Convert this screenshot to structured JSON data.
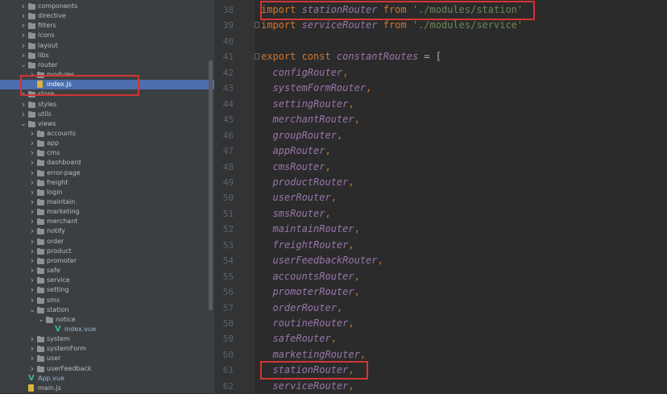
{
  "project_tree": {
    "items": [
      {
        "label": "components",
        "depth": 0,
        "type": "folder",
        "expanded": false
      },
      {
        "label": "directive",
        "depth": 0,
        "type": "folder",
        "expanded": false
      },
      {
        "label": "filters",
        "depth": 0,
        "type": "folder",
        "expanded": false
      },
      {
        "label": "icons",
        "depth": 0,
        "type": "folder",
        "expanded": false
      },
      {
        "label": "layout",
        "depth": 0,
        "type": "folder",
        "expanded": false
      },
      {
        "label": "libs",
        "depth": 0,
        "type": "folder",
        "expanded": false
      },
      {
        "label": "router",
        "depth": 0,
        "type": "folder",
        "expanded": true
      },
      {
        "label": "modules",
        "depth": 1,
        "type": "folder",
        "expanded": false
      },
      {
        "label": "index.js",
        "depth": 1,
        "type": "js",
        "selected": true
      },
      {
        "label": "store",
        "depth": 0,
        "type": "folder",
        "expanded": false
      },
      {
        "label": "styles",
        "depth": 0,
        "type": "folder",
        "expanded": false
      },
      {
        "label": "utils",
        "depth": 0,
        "type": "folder",
        "expanded": false
      },
      {
        "label": "views",
        "depth": 0,
        "type": "folder",
        "expanded": true
      },
      {
        "label": "accounts",
        "depth": 1,
        "type": "folder",
        "expanded": false
      },
      {
        "label": "app",
        "depth": 1,
        "type": "folder",
        "expanded": false
      },
      {
        "label": "cms",
        "depth": 1,
        "type": "folder",
        "expanded": false
      },
      {
        "label": "dashboard",
        "depth": 1,
        "type": "folder",
        "expanded": false
      },
      {
        "label": "error-page",
        "depth": 1,
        "type": "folder",
        "expanded": false
      },
      {
        "label": "freight",
        "depth": 1,
        "type": "folder",
        "expanded": false
      },
      {
        "label": "login",
        "depth": 1,
        "type": "folder",
        "expanded": false
      },
      {
        "label": "maintain",
        "depth": 1,
        "type": "folder",
        "expanded": false
      },
      {
        "label": "marketing",
        "depth": 1,
        "type": "folder",
        "expanded": false
      },
      {
        "label": "merchant",
        "depth": 1,
        "type": "folder",
        "expanded": false
      },
      {
        "label": "notify",
        "depth": 1,
        "type": "folder",
        "expanded": false
      },
      {
        "label": "order",
        "depth": 1,
        "type": "folder",
        "expanded": false
      },
      {
        "label": "product",
        "depth": 1,
        "type": "folder",
        "expanded": false
      },
      {
        "label": "promoter",
        "depth": 1,
        "type": "folder",
        "expanded": false
      },
      {
        "label": "safe",
        "depth": 1,
        "type": "folder",
        "expanded": false
      },
      {
        "label": "service",
        "depth": 1,
        "type": "folder",
        "expanded": false
      },
      {
        "label": "setting",
        "depth": 1,
        "type": "folder",
        "expanded": false
      },
      {
        "label": "sms",
        "depth": 1,
        "type": "folder",
        "expanded": false
      },
      {
        "label": "station",
        "depth": 1,
        "type": "folder",
        "expanded": true
      },
      {
        "label": "notice",
        "depth": 2,
        "type": "folder",
        "expanded": true
      },
      {
        "label": "index.vue",
        "depth": 3,
        "type": "vue"
      },
      {
        "label": "system",
        "depth": 1,
        "type": "folder",
        "expanded": false
      },
      {
        "label": "systemForm",
        "depth": 1,
        "type": "folder",
        "expanded": false
      },
      {
        "label": "user",
        "depth": 1,
        "type": "folder",
        "expanded": false
      },
      {
        "label": "userFeedback",
        "depth": 1,
        "type": "folder",
        "expanded": false
      },
      {
        "label": "App.vue",
        "depth": 0,
        "type": "vue"
      },
      {
        "label": "main.js",
        "depth": 0,
        "type": "js"
      }
    ]
  },
  "editor": {
    "lines": [
      {
        "num": "38",
        "tokens": [
          [
            "kw",
            "import "
          ],
          [
            "id",
            "stationRouter"
          ],
          [
            "kw",
            " from "
          ],
          [
            "str",
            "'./modules/station'"
          ]
        ]
      },
      {
        "num": "39",
        "tokens": [
          [
            "kw",
            "import "
          ],
          [
            "id",
            "serviceRouter"
          ],
          [
            "kw",
            " from "
          ],
          [
            "str",
            "'./modules/service'"
          ]
        ],
        "fold": true
      },
      {
        "num": "40",
        "tokens": []
      },
      {
        "num": "41",
        "tokens": [
          [
            "kw",
            "export const "
          ],
          [
            "id",
            "constantRoutes"
          ],
          [
            "plain",
            " = ["
          ]
        ],
        "fold": true
      },
      {
        "num": "42",
        "tokens": [
          [
            "plain",
            "  "
          ],
          [
            "id",
            "configRouter"
          ],
          [
            "pun",
            ","
          ]
        ]
      },
      {
        "num": "43",
        "tokens": [
          [
            "plain",
            "  "
          ],
          [
            "id",
            "systemFormRouter"
          ],
          [
            "pun",
            ","
          ]
        ]
      },
      {
        "num": "44",
        "tokens": [
          [
            "plain",
            "  "
          ],
          [
            "id",
            "settingRouter"
          ],
          [
            "pun",
            ","
          ]
        ]
      },
      {
        "num": "45",
        "tokens": [
          [
            "plain",
            "  "
          ],
          [
            "id",
            "merchantRouter"
          ],
          [
            "pun",
            ","
          ]
        ]
      },
      {
        "num": "46",
        "tokens": [
          [
            "plain",
            "  "
          ],
          [
            "id",
            "groupRouter"
          ],
          [
            "pun",
            ","
          ]
        ]
      },
      {
        "num": "47",
        "tokens": [
          [
            "plain",
            "  "
          ],
          [
            "id",
            "appRouter"
          ],
          [
            "pun",
            ","
          ]
        ]
      },
      {
        "num": "48",
        "tokens": [
          [
            "plain",
            "  "
          ],
          [
            "id",
            "cmsRouter"
          ],
          [
            "pun",
            ","
          ]
        ]
      },
      {
        "num": "49",
        "tokens": [
          [
            "plain",
            "  "
          ],
          [
            "id",
            "productRouter"
          ],
          [
            "pun",
            ","
          ]
        ]
      },
      {
        "num": "50",
        "tokens": [
          [
            "plain",
            "  "
          ],
          [
            "id",
            "userRouter"
          ],
          [
            "pun",
            ","
          ]
        ]
      },
      {
        "num": "51",
        "tokens": [
          [
            "plain",
            "  "
          ],
          [
            "id",
            "smsRouter"
          ],
          [
            "pun",
            ","
          ]
        ]
      },
      {
        "num": "52",
        "tokens": [
          [
            "plain",
            "  "
          ],
          [
            "id",
            "maintainRouter"
          ],
          [
            "pun",
            ","
          ]
        ]
      },
      {
        "num": "53",
        "tokens": [
          [
            "plain",
            "  "
          ],
          [
            "id",
            "freightRouter"
          ],
          [
            "pun",
            ","
          ]
        ]
      },
      {
        "num": "54",
        "tokens": [
          [
            "plain",
            "  "
          ],
          [
            "id",
            "userFeedbackRouter"
          ],
          [
            "pun",
            ","
          ]
        ]
      },
      {
        "num": "55",
        "tokens": [
          [
            "plain",
            "  "
          ],
          [
            "id",
            "accountsRouter"
          ],
          [
            "pun",
            ","
          ]
        ]
      },
      {
        "num": "56",
        "tokens": [
          [
            "plain",
            "  "
          ],
          [
            "id",
            "promoterRouter"
          ],
          [
            "pun",
            ","
          ]
        ]
      },
      {
        "num": "57",
        "tokens": [
          [
            "plain",
            "  "
          ],
          [
            "id",
            "orderRouter"
          ],
          [
            "pun",
            ","
          ]
        ]
      },
      {
        "num": "58",
        "tokens": [
          [
            "plain",
            "  "
          ],
          [
            "id",
            "routineRouter"
          ],
          [
            "pun",
            ","
          ]
        ]
      },
      {
        "num": "59",
        "tokens": [
          [
            "plain",
            "  "
          ],
          [
            "id",
            "safeRouter"
          ],
          [
            "pun",
            ","
          ]
        ]
      },
      {
        "num": "60",
        "tokens": [
          [
            "plain",
            "  "
          ],
          [
            "id",
            "marketingRouter"
          ],
          [
            "pun",
            ","
          ]
        ]
      },
      {
        "num": "61",
        "tokens": [
          [
            "plain",
            "  "
          ],
          [
            "id",
            "stationRouter"
          ],
          [
            "pun",
            ","
          ]
        ]
      },
      {
        "num": "62",
        "tokens": [
          [
            "plain",
            "  "
          ],
          [
            "id",
            "serviceRouter"
          ],
          [
            "pun",
            ","
          ]
        ]
      }
    ]
  },
  "highlight_color": "#d23535"
}
